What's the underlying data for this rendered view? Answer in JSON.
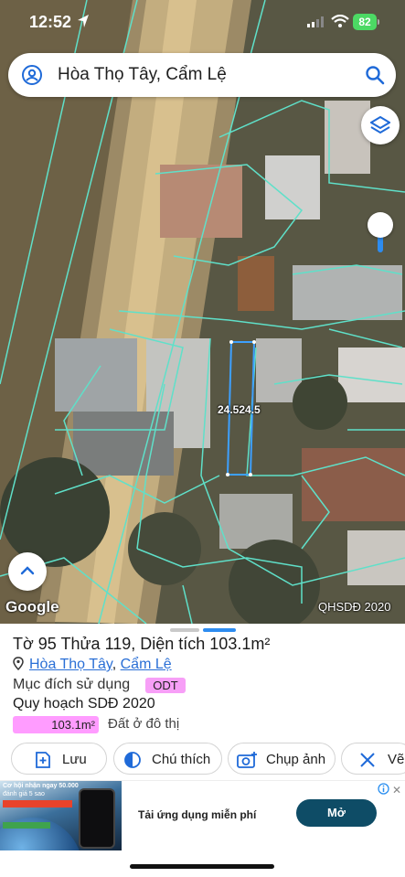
{
  "status_bar": {
    "time": "12:52",
    "battery": "82"
  },
  "search": {
    "value": "Hòa Thọ Tây, Cẩm Lệ"
  },
  "map": {
    "attribution": "Google",
    "layer_label": "QHSDĐ 2020",
    "measurements": [
      "24.5",
      "24.5"
    ]
  },
  "parcel": {
    "title": "Tờ 95 Thửa 119, Diện tích 103.1m²",
    "ward": "Hòa Thọ Tây",
    "separator": ",",
    "district": "Cẩm Lệ",
    "purpose_label": "Mục đích sử dụng",
    "purpose_code": "ODT",
    "plan_label": "Quy hoạch SDĐ 2020",
    "plan_area": "103.1m²",
    "land_type": "Đất ở đô thị"
  },
  "actions": [
    {
      "label": "Lưu",
      "icon": "bookmark-plus-icon"
    },
    {
      "label": "Chú thích",
      "icon": "contrast-icon"
    },
    {
      "label": "Chụp ảnh",
      "icon": "camera-plus-icon"
    },
    {
      "label": "Vẽ",
      "icon": "ruler-pen-icon"
    }
  ],
  "ad": {
    "headline": "Tải ứng dụng miễn phí",
    "button": "Mở",
    "image_text_1": "Cơ hội nhận ngay 50.000",
    "image_text_2": "đánh giá 5 sao"
  },
  "colors": {
    "parcel_lines": "#5fe0c9",
    "measure_line": "#3da0ff",
    "badge": "#f79ff7",
    "ad_button": "#0e4c66",
    "link": "#2a6fd6"
  }
}
